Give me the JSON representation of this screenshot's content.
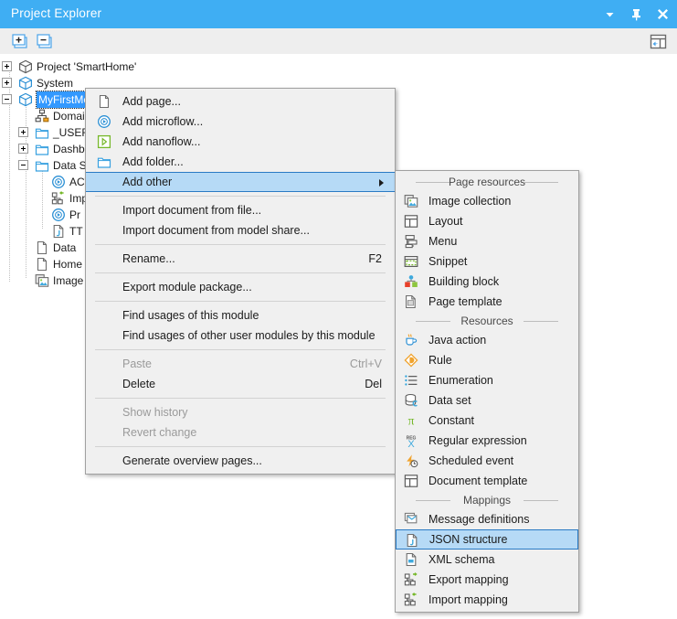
{
  "window": {
    "title": "Project Explorer",
    "titlebar_color": "#3faef3",
    "buttons": [
      {
        "name": "menu-chevron-icon",
        "label": "▾"
      },
      {
        "name": "pin-icon",
        "label": "pin"
      },
      {
        "name": "close-icon",
        "label": "✕"
      }
    ]
  },
  "toolbar": {
    "expand_all_label": "Expand all",
    "collapse_all_label": "Collapse all",
    "dock_label": "Dock"
  },
  "tree": {
    "items": [
      {
        "label": "Project 'SmartHome'",
        "icon": "package-icon",
        "expander": "plus",
        "indent": 0,
        "selected": false
      },
      {
        "label": "System",
        "icon": "module-icon",
        "expander": "plus",
        "indent": 0,
        "selected": false
      },
      {
        "label": "MyFirstModule",
        "icon": "module-icon",
        "expander": "minus",
        "indent": 0,
        "selected": true
      },
      {
        "label": "Domain Model",
        "icon": "domain-model-icon",
        "expander": "none",
        "indent": 1,
        "selected": false
      },
      {
        "label": "_USER_LIB",
        "icon": "folder-icon",
        "expander": "plus",
        "indent": 1,
        "selected": false
      },
      {
        "label": "Dashboard",
        "icon": "folder-icon",
        "expander": "plus",
        "indent": 1,
        "selected": false
      },
      {
        "label": "Data Sources",
        "icon": "folder-icon",
        "expander": "minus",
        "indent": 1,
        "selected": false
      },
      {
        "label": "ACT_",
        "icon": "microflow-icon",
        "expander": "none",
        "indent": 2,
        "selected": false
      },
      {
        "label": "Import",
        "icon": "import-mapping-icon",
        "expander": "none",
        "indent": 2,
        "selected": false
      },
      {
        "label": "Pr",
        "icon": "microflow-icon",
        "expander": "none",
        "indent": 2,
        "selected": false
      },
      {
        "label": "TT",
        "icon": "json-structure-icon",
        "expander": "none",
        "indent": 2,
        "selected": false
      },
      {
        "label": "Data",
        "icon": "page-icon",
        "expander": "none",
        "indent": 1,
        "selected": false
      },
      {
        "label": "Home",
        "icon": "page-icon",
        "expander": "none",
        "indent": 1,
        "selected": false
      },
      {
        "label": "Image",
        "icon": "image-collection-icon",
        "expander": "none",
        "indent": 1,
        "selected": false
      }
    ]
  },
  "context_menu": {
    "items": [
      {
        "type": "item",
        "label": "Add page...",
        "icon": "page-icon",
        "accel": "",
        "state": "normal"
      },
      {
        "type": "item",
        "label": "Add microflow...",
        "icon": "microflow-icon",
        "accel": "",
        "state": "normal"
      },
      {
        "type": "item",
        "label": "Add nanoflow...",
        "icon": "nanoflow-icon",
        "accel": "",
        "state": "normal"
      },
      {
        "type": "item",
        "label": "Add folder...",
        "icon": "folder-icon",
        "accel": "",
        "state": "normal"
      },
      {
        "type": "item",
        "label": "Add other",
        "icon": "",
        "accel": "",
        "state": "selected",
        "submenu": true
      },
      {
        "type": "separator"
      },
      {
        "type": "item",
        "label": "Import document from file...",
        "icon": "",
        "accel": "",
        "state": "normal"
      },
      {
        "type": "item",
        "label": "Import document from model share...",
        "icon": "",
        "accel": "",
        "state": "normal"
      },
      {
        "type": "separator"
      },
      {
        "type": "item",
        "label": "Rename...",
        "icon": "",
        "accel": "F2",
        "state": "normal"
      },
      {
        "type": "separator"
      },
      {
        "type": "item",
        "label": "Export module package...",
        "icon": "",
        "accel": "",
        "state": "normal"
      },
      {
        "type": "separator"
      },
      {
        "type": "item",
        "label": "Find usages of this module",
        "icon": "",
        "accel": "",
        "state": "normal"
      },
      {
        "type": "item",
        "label": "Find usages of other user modules by this module",
        "icon": "",
        "accel": "",
        "state": "normal"
      },
      {
        "type": "separator"
      },
      {
        "type": "item",
        "label": "Paste",
        "icon": "",
        "accel": "Ctrl+V",
        "state": "disabled"
      },
      {
        "type": "item",
        "label": "Delete",
        "icon": "",
        "accel": "Del",
        "state": "normal"
      },
      {
        "type": "separator"
      },
      {
        "type": "item",
        "label": "Show history",
        "icon": "",
        "accel": "",
        "state": "disabled"
      },
      {
        "type": "item",
        "label": "Revert change",
        "icon": "",
        "accel": "",
        "state": "disabled"
      },
      {
        "type": "separator"
      },
      {
        "type": "item",
        "label": "Generate overview pages...",
        "icon": "",
        "accel": "",
        "state": "normal"
      }
    ]
  },
  "submenu": {
    "items": [
      {
        "type": "category",
        "label": "Page resources"
      },
      {
        "type": "item",
        "label": "Image collection",
        "icon": "image-collection-icon",
        "state": "normal"
      },
      {
        "type": "item",
        "label": "Layout",
        "icon": "layout-icon",
        "state": "normal"
      },
      {
        "type": "item",
        "label": "Menu",
        "icon": "menu-icon",
        "state": "normal"
      },
      {
        "type": "item",
        "label": "Snippet",
        "icon": "snippet-icon",
        "state": "normal"
      },
      {
        "type": "item",
        "label": "Building block",
        "icon": "building-block-icon",
        "state": "normal"
      },
      {
        "type": "item",
        "label": "Page template",
        "icon": "page-template-icon",
        "state": "normal"
      },
      {
        "type": "category",
        "label": "Resources"
      },
      {
        "type": "item",
        "label": "Java action",
        "icon": "java-action-icon",
        "state": "normal"
      },
      {
        "type": "item",
        "label": "Rule",
        "icon": "rule-icon",
        "state": "normal"
      },
      {
        "type": "item",
        "label": "Enumeration",
        "icon": "enumeration-icon",
        "state": "normal"
      },
      {
        "type": "item",
        "label": "Data set",
        "icon": "data-set-icon",
        "state": "normal"
      },
      {
        "type": "item",
        "label": "Constant",
        "icon": "constant-icon",
        "state": "normal"
      },
      {
        "type": "item",
        "label": "Regular expression",
        "icon": "regular-expression-icon",
        "state": "normal"
      },
      {
        "type": "item",
        "label": "Scheduled event",
        "icon": "scheduled-event-icon",
        "state": "normal"
      },
      {
        "type": "item",
        "label": "Document template",
        "icon": "document-template-icon",
        "state": "normal"
      },
      {
        "type": "category",
        "label": "Mappings"
      },
      {
        "type": "item",
        "label": "Message definitions",
        "icon": "message-definitions-icon",
        "state": "normal"
      },
      {
        "type": "item",
        "label": "JSON structure",
        "icon": "json-structure-icon",
        "state": "selected"
      },
      {
        "type": "item",
        "label": "XML schema",
        "icon": "xml-schema-icon",
        "state": "normal"
      },
      {
        "type": "item",
        "label": "Export mapping",
        "icon": "export-mapping-icon",
        "state": "normal"
      },
      {
        "type": "item",
        "label": "Import mapping",
        "icon": "import-mapping-icon",
        "state": "normal"
      }
    ]
  }
}
